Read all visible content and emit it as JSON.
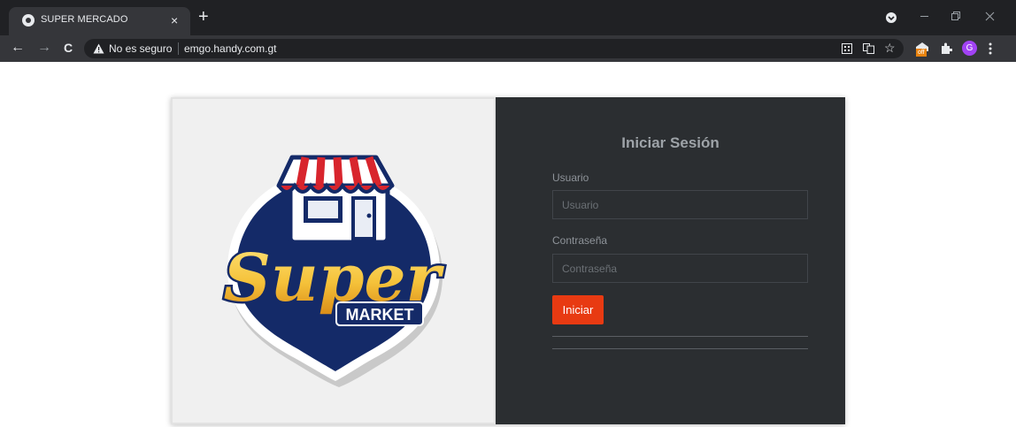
{
  "browser": {
    "tab_title": "SUPER MERCADO",
    "tab_close": "×",
    "new_tab": "+",
    "nav_back": "←",
    "nav_forward": "→",
    "nav_reload": "C",
    "security_icon": "warning-icon",
    "security_text": "No es seguro",
    "url": "emgo.handy.com.gt",
    "extension_badge": "off",
    "profile_initial": "G"
  },
  "logo": {
    "word": "Super",
    "subword": "MARKET",
    "colors": {
      "navy": "#142a68",
      "gold": "#f5c23a",
      "red": "#d8252d"
    }
  },
  "login": {
    "title": "Iniciar Sesión",
    "user_label": "Usuario",
    "user_placeholder": "Usuario",
    "user_value": "",
    "password_label": "Contraseña",
    "password_placeholder": "Contraseña",
    "password_value": "",
    "submit_label": "Iniciar",
    "accent_color": "#e83a12"
  }
}
